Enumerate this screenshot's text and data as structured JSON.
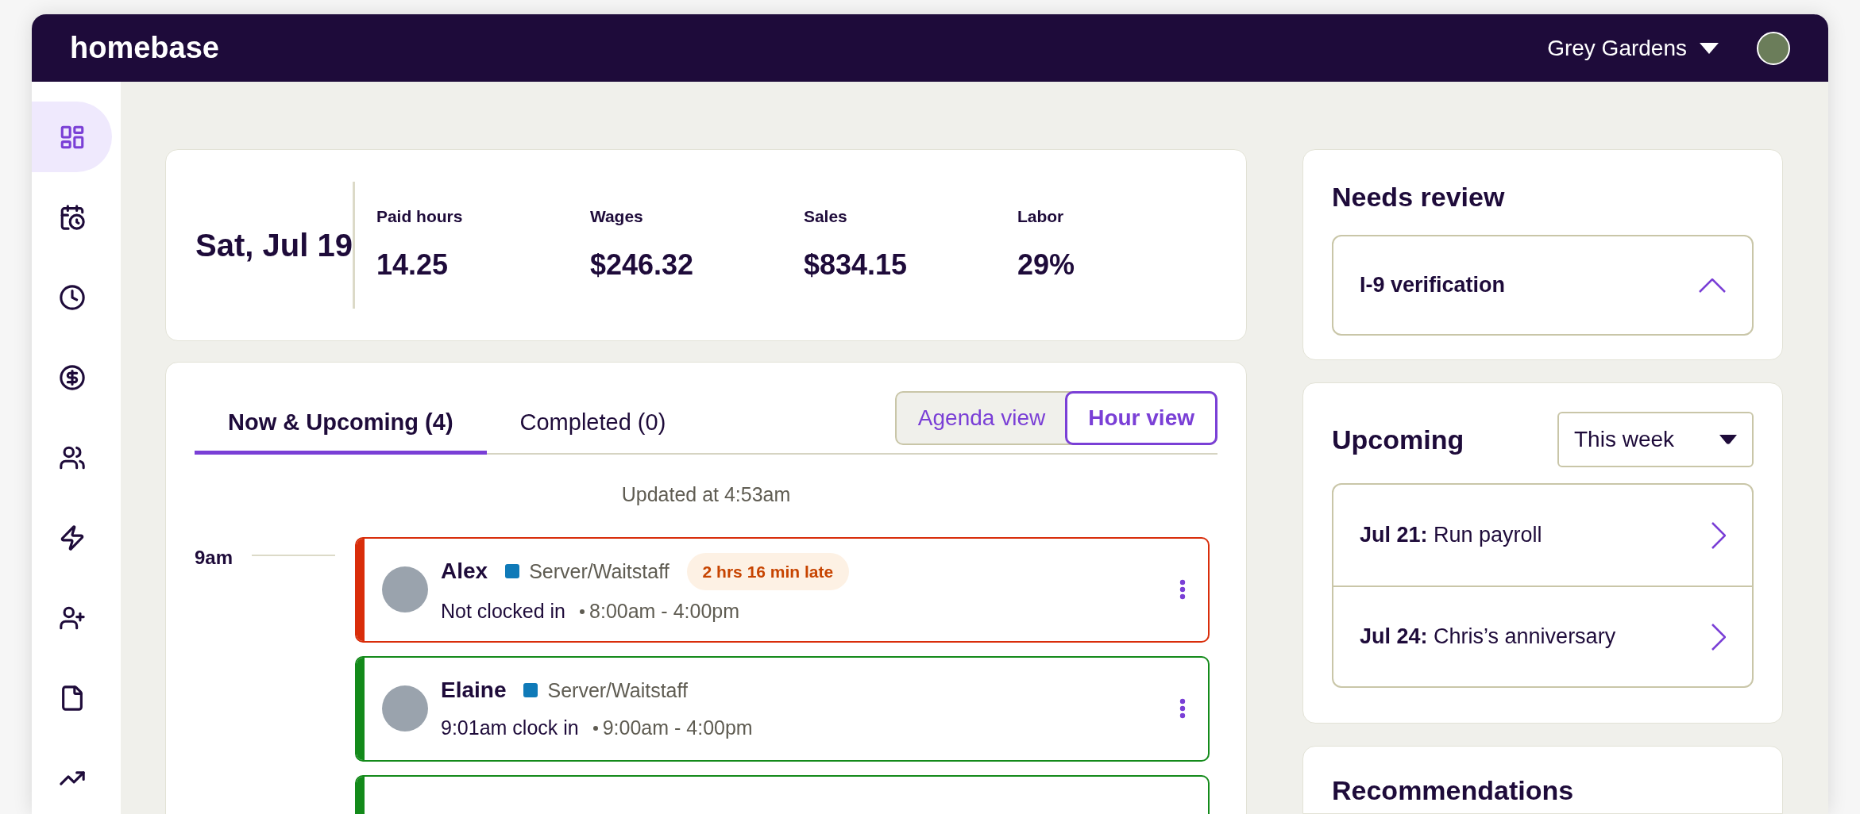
{
  "header": {
    "logo": "homebase",
    "location": "Grey Gardens"
  },
  "sidebar": {
    "items": [
      {
        "selected": true
      },
      {
        "selected": false
      },
      {
        "selected": false
      },
      {
        "selected": false
      },
      {
        "selected": false
      },
      {
        "selected": false
      },
      {
        "selected": false
      },
      {
        "selected": false
      },
      {
        "selected": false
      }
    ]
  },
  "summary": {
    "date": "Sat, Jul 19",
    "stats": [
      {
        "label": "Paid hours",
        "value": "14.25"
      },
      {
        "label": "Wages",
        "value": "$246.32"
      },
      {
        "label": "Sales",
        "value": "$834.15"
      },
      {
        "label": "Labor",
        "value": "29%"
      }
    ]
  },
  "shifts": {
    "tabs": [
      {
        "label": "Now & Upcoming (4)",
        "selected": true
      },
      {
        "label": "Completed (0)",
        "selected": false
      }
    ],
    "views": [
      {
        "label": "Agenda view",
        "selected": false
      },
      {
        "label": "Hour view",
        "selected": true
      }
    ],
    "updated": "Updated at 4:53am",
    "hour": "9am",
    "items": [
      {
        "kind": "late",
        "name": "Alex",
        "role": "Server/Waitstaff",
        "badge": "2 hrs 16 min late",
        "clock": "Not clocked in",
        "time": "8:00am - 4:00pm"
      },
      {
        "kind": "on_time",
        "name": "Elaine",
        "role": "Server/Waitstaff",
        "clock": "9:01am clock in",
        "time": "9:00am - 4:00pm"
      },
      {
        "kind": "on_time"
      }
    ]
  },
  "needs_review": {
    "title": "Needs review",
    "items": [
      {
        "label": "I-9 verification",
        "expanded": true
      }
    ]
  },
  "upcoming": {
    "title": "Upcoming",
    "filter": "This week",
    "items": [
      {
        "date": "Jul 21:",
        "text": "Run payroll"
      },
      {
        "date": "Jul 24:",
        "text": "Chris’s anniversary"
      }
    ]
  },
  "recommendations": {
    "title": "Recommendations"
  }
}
